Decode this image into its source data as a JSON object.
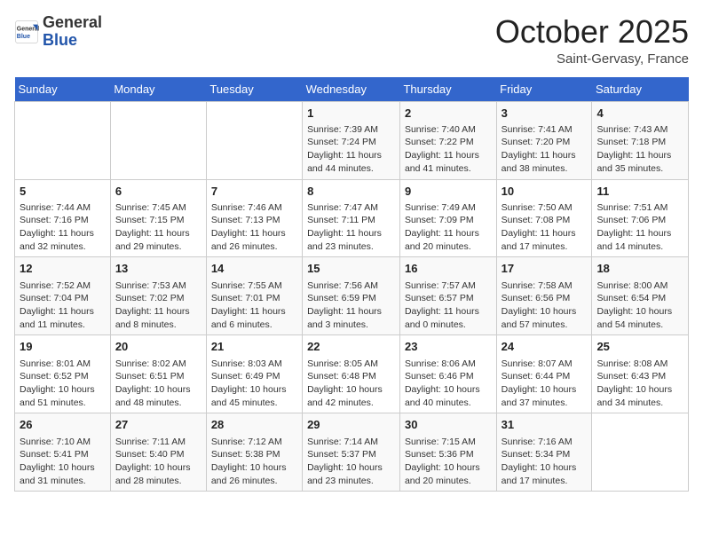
{
  "header": {
    "logo_general": "General",
    "logo_blue": "Blue",
    "month": "October 2025",
    "location": "Saint-Gervasy, France"
  },
  "days_of_week": [
    "Sunday",
    "Monday",
    "Tuesday",
    "Wednesday",
    "Thursday",
    "Friday",
    "Saturday"
  ],
  "weeks": [
    [
      {
        "day": "",
        "content": ""
      },
      {
        "day": "",
        "content": ""
      },
      {
        "day": "",
        "content": ""
      },
      {
        "day": "1",
        "content": "Sunrise: 7:39 AM\nSunset: 7:24 PM\nDaylight: 11 hours and 44 minutes."
      },
      {
        "day": "2",
        "content": "Sunrise: 7:40 AM\nSunset: 7:22 PM\nDaylight: 11 hours and 41 minutes."
      },
      {
        "day": "3",
        "content": "Sunrise: 7:41 AM\nSunset: 7:20 PM\nDaylight: 11 hours and 38 minutes."
      },
      {
        "day": "4",
        "content": "Sunrise: 7:43 AM\nSunset: 7:18 PM\nDaylight: 11 hours and 35 minutes."
      }
    ],
    [
      {
        "day": "5",
        "content": "Sunrise: 7:44 AM\nSunset: 7:16 PM\nDaylight: 11 hours and 32 minutes."
      },
      {
        "day": "6",
        "content": "Sunrise: 7:45 AM\nSunset: 7:15 PM\nDaylight: 11 hours and 29 minutes."
      },
      {
        "day": "7",
        "content": "Sunrise: 7:46 AM\nSunset: 7:13 PM\nDaylight: 11 hours and 26 minutes."
      },
      {
        "day": "8",
        "content": "Sunrise: 7:47 AM\nSunset: 7:11 PM\nDaylight: 11 hours and 23 minutes."
      },
      {
        "day": "9",
        "content": "Sunrise: 7:49 AM\nSunset: 7:09 PM\nDaylight: 11 hours and 20 minutes."
      },
      {
        "day": "10",
        "content": "Sunrise: 7:50 AM\nSunset: 7:08 PM\nDaylight: 11 hours and 17 minutes."
      },
      {
        "day": "11",
        "content": "Sunrise: 7:51 AM\nSunset: 7:06 PM\nDaylight: 11 hours and 14 minutes."
      }
    ],
    [
      {
        "day": "12",
        "content": "Sunrise: 7:52 AM\nSunset: 7:04 PM\nDaylight: 11 hours and 11 minutes."
      },
      {
        "day": "13",
        "content": "Sunrise: 7:53 AM\nSunset: 7:02 PM\nDaylight: 11 hours and 8 minutes."
      },
      {
        "day": "14",
        "content": "Sunrise: 7:55 AM\nSunset: 7:01 PM\nDaylight: 11 hours and 6 minutes."
      },
      {
        "day": "15",
        "content": "Sunrise: 7:56 AM\nSunset: 6:59 PM\nDaylight: 11 hours and 3 minutes."
      },
      {
        "day": "16",
        "content": "Sunrise: 7:57 AM\nSunset: 6:57 PM\nDaylight: 11 hours and 0 minutes."
      },
      {
        "day": "17",
        "content": "Sunrise: 7:58 AM\nSunset: 6:56 PM\nDaylight: 10 hours and 57 minutes."
      },
      {
        "day": "18",
        "content": "Sunrise: 8:00 AM\nSunset: 6:54 PM\nDaylight: 10 hours and 54 minutes."
      }
    ],
    [
      {
        "day": "19",
        "content": "Sunrise: 8:01 AM\nSunset: 6:52 PM\nDaylight: 10 hours and 51 minutes."
      },
      {
        "day": "20",
        "content": "Sunrise: 8:02 AM\nSunset: 6:51 PM\nDaylight: 10 hours and 48 minutes."
      },
      {
        "day": "21",
        "content": "Sunrise: 8:03 AM\nSunset: 6:49 PM\nDaylight: 10 hours and 45 minutes."
      },
      {
        "day": "22",
        "content": "Sunrise: 8:05 AM\nSunset: 6:48 PM\nDaylight: 10 hours and 42 minutes."
      },
      {
        "day": "23",
        "content": "Sunrise: 8:06 AM\nSunset: 6:46 PM\nDaylight: 10 hours and 40 minutes."
      },
      {
        "day": "24",
        "content": "Sunrise: 8:07 AM\nSunset: 6:44 PM\nDaylight: 10 hours and 37 minutes."
      },
      {
        "day": "25",
        "content": "Sunrise: 8:08 AM\nSunset: 6:43 PM\nDaylight: 10 hours and 34 minutes."
      }
    ],
    [
      {
        "day": "26",
        "content": "Sunrise: 7:10 AM\nSunset: 5:41 PM\nDaylight: 10 hours and 31 minutes."
      },
      {
        "day": "27",
        "content": "Sunrise: 7:11 AM\nSunset: 5:40 PM\nDaylight: 10 hours and 28 minutes."
      },
      {
        "day": "28",
        "content": "Sunrise: 7:12 AM\nSunset: 5:38 PM\nDaylight: 10 hours and 26 minutes."
      },
      {
        "day": "29",
        "content": "Sunrise: 7:14 AM\nSunset: 5:37 PM\nDaylight: 10 hours and 23 minutes."
      },
      {
        "day": "30",
        "content": "Sunrise: 7:15 AM\nSunset: 5:36 PM\nDaylight: 10 hours and 20 minutes."
      },
      {
        "day": "31",
        "content": "Sunrise: 7:16 AM\nSunset: 5:34 PM\nDaylight: 10 hours and 17 minutes."
      },
      {
        "day": "",
        "content": ""
      }
    ]
  ]
}
